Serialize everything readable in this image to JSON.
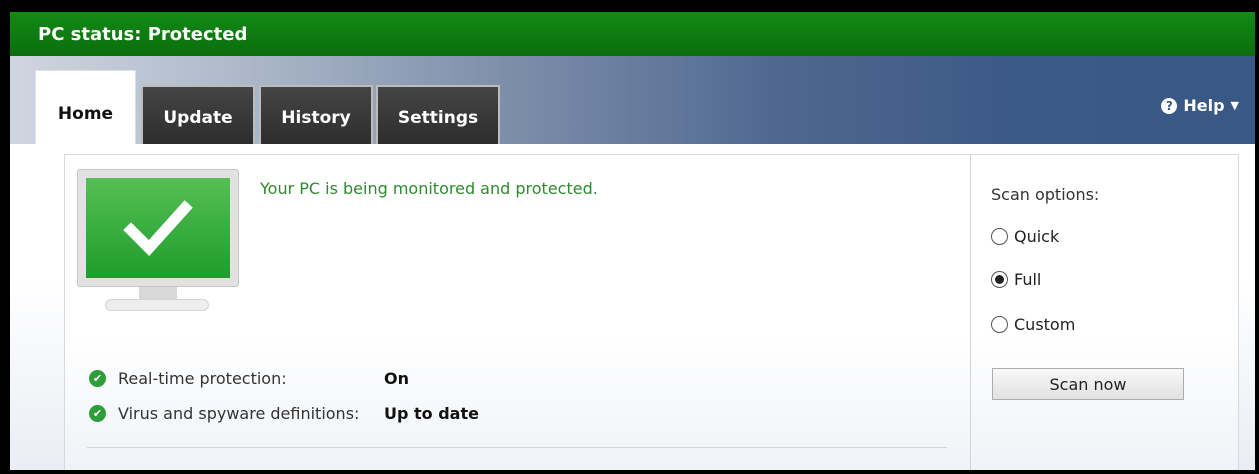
{
  "window": {
    "title": "PC status: Protected"
  },
  "tabs": [
    {
      "label": "Home",
      "active": true
    },
    {
      "label": "Update",
      "active": false
    },
    {
      "label": "History",
      "active": false
    },
    {
      "label": "Settings",
      "active": false
    }
  ],
  "help": {
    "label": "Help",
    "icon": "question-circle-icon"
  },
  "main": {
    "status_message": "Your PC is being monitored and protected.",
    "monitor_icon": "check-monitor-icon",
    "status_items": [
      {
        "label": "Real-time protection:",
        "value": "On",
        "icon": "check-circle-icon"
      },
      {
        "label": "Virus and spyware definitions:",
        "value": "Up to date",
        "icon": "check-circle-icon"
      }
    ]
  },
  "scan": {
    "title": "Scan options:",
    "options": [
      {
        "label": "Quick",
        "selected": false
      },
      {
        "label": "Full",
        "selected": true
      },
      {
        "label": "Custom",
        "selected": false
      }
    ],
    "button_label": "Scan now"
  },
  "colors": {
    "titlebar": "#138a16",
    "header_blue": "#3a5885",
    "status_green": "#2e8b2e",
    "ok_icon": "#2d9e3a"
  }
}
